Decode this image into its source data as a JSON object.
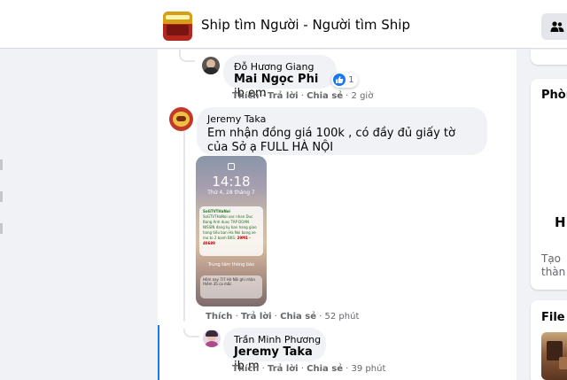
{
  "header": {
    "group_title": "Ship tìm Người - Người tìm Ship",
    "members_icon": "people-icon"
  },
  "comments": [
    {
      "author": "Đỗ Hương Giang",
      "mention": "Mai Ngọc Phi",
      "text": " ib em",
      "reaction_count": "1",
      "actions": {
        "like": "Thích",
        "reply": "Trả lời",
        "share": "Chia sẻ",
        "time": "2 giờ"
      }
    },
    {
      "author": "Jeremy Taka",
      "text": "Em nhận đồng giá 100k , có đầy đủ giấy tờ của Sở ạ FULL HÀ NỘI",
      "attachment": {
        "time": "14:18",
        "date": "Thứ 4, 28 tháng 7",
        "sender": "SoGTVTHaNoi",
        "body": "SoGTVTHaNoi xac nhan Duc Bang Anh duoc TAP DOAN NISSIN dang ky ban hang giao hang tiêu ban Ha Noi bang xe mo to 2 banh BKS: ",
        "plate": "29M1 - 40689",
        "sub": "Trung tâm thông báo",
        "notif2": "Hôm nay 7/7 Hà Nội ghi nhận thêm 35 ca mắc"
      },
      "actions": {
        "like": "Thích",
        "reply": "Trả lời",
        "share": "Chia sẻ",
        "time": "52 phút"
      }
    },
    {
      "author": "Trần Minh Phương",
      "mention": "Jeremy Taka",
      "text": " ib m",
      "actions": {
        "like": "Thích",
        "reply": "Trả lời",
        "share": "Chia sẻ",
        "time": "39 phút"
      }
    }
  ],
  "sidebar": {
    "card1_title": "Phòn",
    "card1_big": "H",
    "card1_text1": "Tạo",
    "card1_text2": "thàn",
    "card2_title": "File p"
  },
  "colors": {
    "accent": "#1877f2",
    "bubble": "#f0f2f5",
    "meta": "#65676b"
  }
}
